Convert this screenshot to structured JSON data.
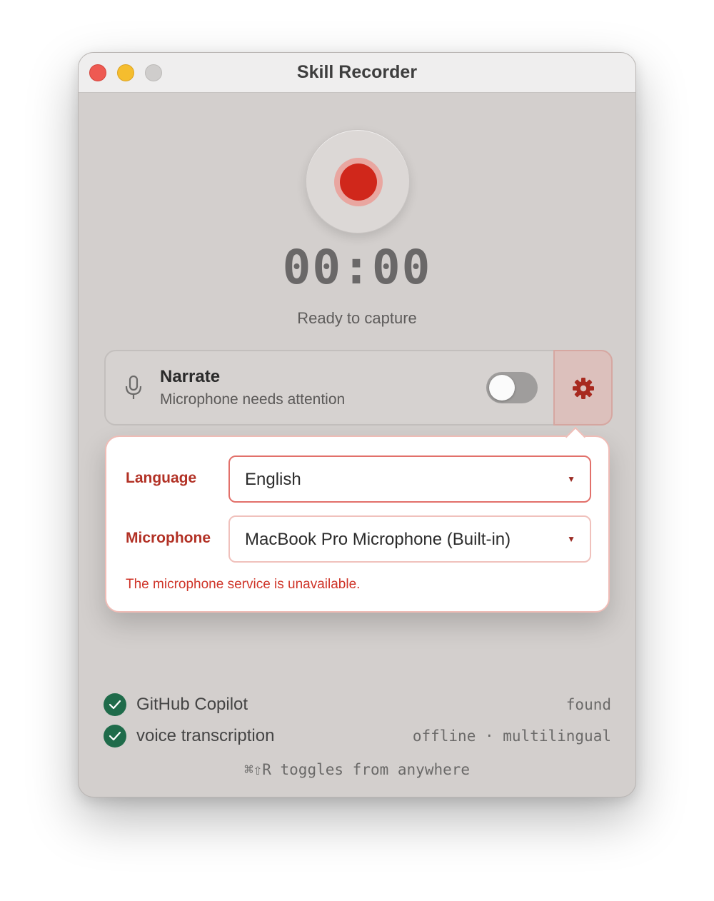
{
  "window": {
    "title": "Skill Recorder"
  },
  "recorder": {
    "timer": "00:00",
    "status": "Ready to capture"
  },
  "narrate": {
    "title": "Narrate",
    "subtitle": "Microphone needs attention",
    "toggle_on": false
  },
  "settings": {
    "language_label": "Language",
    "language_value": "English",
    "microphone_label": "Microphone",
    "microphone_value": "MacBook Pro Microphone (Built-in)",
    "error": "The microphone service is unavailable."
  },
  "checks": [
    {
      "label": "GitHub Copilot",
      "value": "found"
    },
    {
      "label": "voice transcription",
      "value": "offline · multilingual"
    }
  ],
  "footer": {
    "shortcut": "⌘⇧R toggles from anywhere"
  },
  "colors": {
    "accent": "#d0271b",
    "error": "#cf3428",
    "check": "#1f6b4a"
  }
}
